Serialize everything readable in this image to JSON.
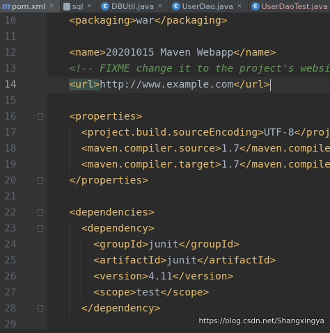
{
  "tabs": [
    {
      "label": "pom.xml",
      "icon": "maven-icon",
      "active": true
    },
    {
      "label": "sql",
      "icon": "sql-file-icon"
    },
    {
      "label": "DBUtil.java",
      "icon": "java-class-icon"
    },
    {
      "label": "UserDao.java",
      "icon": "java-class-icon"
    },
    {
      "label": "UserDaoTest.java",
      "icon": "java-class-icon"
    }
  ],
  "close_glyph": "×",
  "editor": {
    "current_line": 14,
    "lines": [
      {
        "n": "10",
        "indent": "  ",
        "parts": [
          [
            "t",
            "<packaging>"
          ],
          [
            "x",
            "war"
          ],
          [
            "t",
            "</packaging>"
          ]
        ]
      },
      {
        "n": "11",
        "indent": "",
        "parts": []
      },
      {
        "n": "12",
        "indent": "  ",
        "parts": [
          [
            "t",
            "<name>"
          ],
          [
            "x",
            "20201015 Maven Webapp"
          ],
          [
            "t",
            "</name>"
          ]
        ]
      },
      {
        "n": "13",
        "indent": "  ",
        "parts": [
          [
            "cm",
            "<!-- FIXME change it to the project's website -->"
          ]
        ]
      },
      {
        "n": "14",
        "indent": "  ",
        "parts": [
          [
            "t",
            "<url>"
          ],
          [
            "x",
            "http://www.example.com"
          ],
          [
            "t",
            "</url>"
          ]
        ]
      },
      {
        "n": "15",
        "indent": "",
        "parts": []
      },
      {
        "n": "16",
        "indent": "  ",
        "parts": [
          [
            "t",
            "<properties>"
          ]
        ]
      },
      {
        "n": "17",
        "indent": "    ",
        "parts": [
          [
            "t",
            "<project.build.sourceEncoding>"
          ],
          [
            "x",
            "UTF-8"
          ],
          [
            "t",
            "</project.build.sourceEncoding>"
          ]
        ]
      },
      {
        "n": "18",
        "indent": "    ",
        "parts": [
          [
            "t",
            "<maven.compiler.source>"
          ],
          [
            "x",
            "1.7"
          ],
          [
            "t",
            "</maven.compiler.source>"
          ]
        ]
      },
      {
        "n": "19",
        "indent": "    ",
        "parts": [
          [
            "t",
            "<maven.compiler.target>"
          ],
          [
            "x",
            "1.7"
          ],
          [
            "t",
            "</maven.compiler.target>"
          ]
        ]
      },
      {
        "n": "20",
        "indent": "  ",
        "parts": [
          [
            "t",
            "</properties>"
          ]
        ]
      },
      {
        "n": "21",
        "indent": "",
        "parts": []
      },
      {
        "n": "22",
        "indent": "  ",
        "parts": [
          [
            "t",
            "<dependencies>"
          ]
        ]
      },
      {
        "n": "23",
        "indent": "    ",
        "parts": [
          [
            "t",
            "<dependency>"
          ]
        ]
      },
      {
        "n": "24",
        "indent": "      ",
        "parts": [
          [
            "t",
            "<groupId>"
          ],
          [
            "x",
            "junit"
          ],
          [
            "t",
            "</groupId>"
          ]
        ]
      },
      {
        "n": "25",
        "indent": "      ",
        "parts": [
          [
            "t",
            "<artifactId>"
          ],
          [
            "x",
            "junit"
          ],
          [
            "t",
            "</artifactId>"
          ]
        ]
      },
      {
        "n": "26",
        "indent": "      ",
        "parts": [
          [
            "t",
            "<version>"
          ],
          [
            "x",
            "4.11"
          ],
          [
            "t",
            "</version>"
          ]
        ]
      },
      {
        "n": "27",
        "indent": "      ",
        "parts": [
          [
            "t",
            "<scope>"
          ],
          [
            "x",
            "test"
          ],
          [
            "t",
            "</scope>"
          ]
        ]
      },
      {
        "n": "28",
        "indent": "    ",
        "parts": [
          [
            "t",
            "</dependency>"
          ]
        ]
      },
      {
        "n": "29",
        "indent": "",
        "parts": []
      }
    ]
  },
  "watermark": "https://blog.csdn.net/Shangxingya",
  "colors": {
    "tag": "#e8bf6a",
    "text": "#a9b7c6",
    "comment": "#629755",
    "background": "#2b2b2b",
    "gutter": "#313335"
  }
}
